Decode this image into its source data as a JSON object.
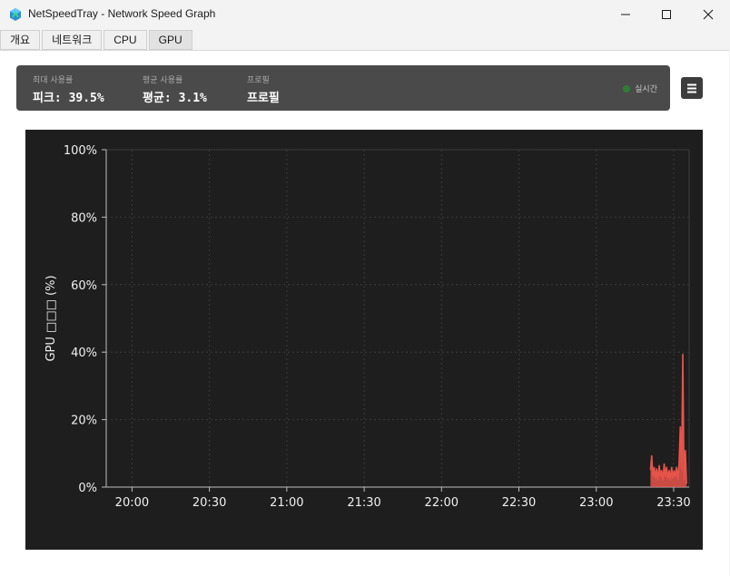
{
  "window": {
    "title": "NetSpeedTray - Network Speed Graph",
    "controls": [
      "minimize",
      "maximize",
      "close"
    ]
  },
  "tabs": [
    {
      "label": "개요",
      "active": false
    },
    {
      "label": "네트워크",
      "active": false
    },
    {
      "label": "CPU",
      "active": false
    },
    {
      "label": "GPU",
      "active": true
    }
  ],
  "stats": {
    "max_label": "최대 사용률",
    "max_value": "피크: 39.5%",
    "avg_label": "평균 사용률",
    "avg_value": "평균: 3.1%",
    "profile_label": "프로필",
    "profile_value": "프로필",
    "live_label": "실시간",
    "live_color": "#2e7d32"
  },
  "icons": {
    "app": "netspeedtray-icon",
    "menu": "hamburger-menu-icon"
  },
  "colors": {
    "chart_bg": "#1e1e1e",
    "series": "#e8544a",
    "statsbar_bg": "#4a4a4a"
  },
  "chart_data": {
    "type": "area",
    "xlabel": "",
    "ylabel": "GPU □□□ (%)",
    "ylim": [
      0,
      100
    ],
    "xlim": [
      "19:50",
      "23:36"
    ],
    "yticks": [
      "0%",
      "20%",
      "40%",
      "60%",
      "80%",
      "100%"
    ],
    "xticks": [
      "20:00",
      "20:30",
      "21:00",
      "21:30",
      "22:00",
      "22:30",
      "23:00",
      "23:30"
    ],
    "grid": true,
    "series": [
      {
        "values": [
          [
            "23:21",
            5
          ],
          [
            "23:21",
            9.4
          ],
          [
            "23:22",
            3
          ],
          [
            "23:22",
            6
          ],
          [
            "23:23",
            2.5
          ],
          [
            "23:23",
            5.5
          ],
          [
            "23:24",
            2
          ],
          [
            "23:24",
            6.5
          ],
          [
            "23:25",
            3
          ],
          [
            "23:25",
            5
          ],
          [
            "23:26",
            2
          ],
          [
            "23:26",
            7
          ],
          [
            "23:27",
            3
          ],
          [
            "23:27",
            6
          ],
          [
            "23:28",
            2.5
          ],
          [
            "23:28",
            5
          ],
          [
            "23:29",
            2
          ],
          [
            "23:29",
            6
          ],
          [
            "23:30",
            2.5
          ],
          [
            "23:30",
            5
          ],
          [
            "23:31",
            3
          ],
          [
            "23:31",
            6
          ],
          [
            "23:32",
            2
          ],
          [
            "23:32",
            7
          ],
          [
            "23:33",
            18
          ],
          [
            "23:33",
            5
          ],
          [
            "23:34",
            39.5
          ],
          [
            "23:34",
            2
          ],
          [
            "23:35",
            11
          ],
          [
            "23:35",
            1
          ]
        ]
      }
    ]
  }
}
